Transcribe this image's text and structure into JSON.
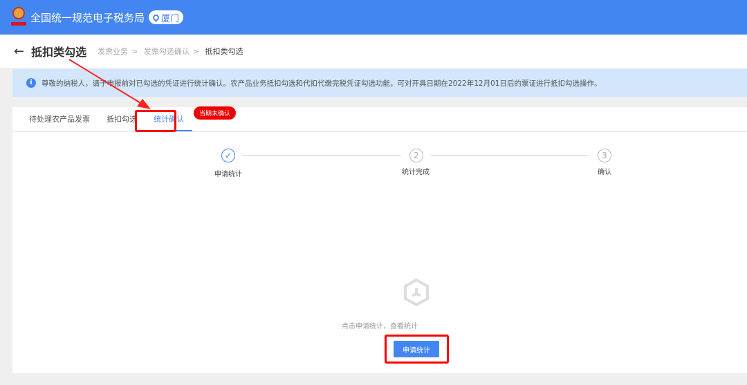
{
  "header": {
    "title": "全国统一规范电子税务局",
    "location": "厦门"
  },
  "page": {
    "title": "抵扣类勾选",
    "breadcrumb": [
      "发票业务",
      "发票勾选确认",
      "抵扣类勾选"
    ]
  },
  "notice": "尊敬的纳税人，请于申报前对已勾选的凭证进行统计确认。农产品业务抵扣勾选和代扣代缴完税凭证勾选功能，可对开具日期在2022年12月01日后的票证进行抵扣勾选操作。",
  "tabs": [
    {
      "label": "待处理农产品发票"
    },
    {
      "label": "抵扣勾选"
    },
    {
      "label": "统计确认",
      "badge": "当期未确认"
    }
  ],
  "steps": [
    {
      "num": "✓",
      "label": "申请统计"
    },
    {
      "num": "2",
      "label": "统计完成"
    },
    {
      "num": "3",
      "label": "确认"
    }
  ],
  "empty": {
    "hint": "点击申请统计，查看统计",
    "button": "申请统计"
  }
}
